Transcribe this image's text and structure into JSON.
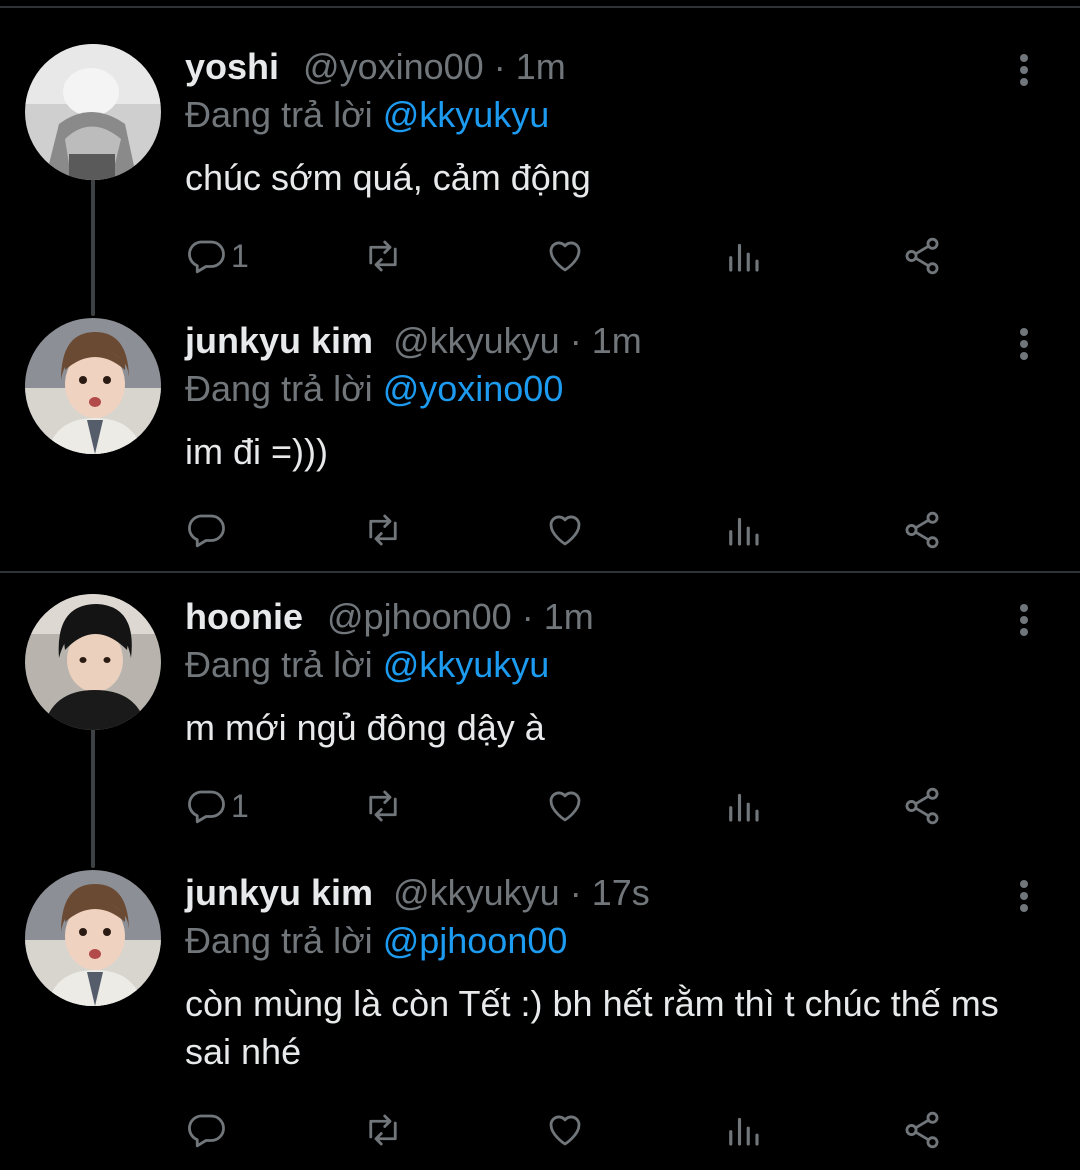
{
  "replying_prefix": "Đang trả lời",
  "tweets": [
    {
      "name": "yoshi",
      "handle": "@yoxino00",
      "time": "1m",
      "reply_to": "@kkyukyu",
      "text": "chúc sớm quá, cảm động",
      "reply_count": "1",
      "avatar": "grayscale-photo"
    },
    {
      "name": "junkyu kim",
      "handle": "@kkyukyu",
      "time": "1m",
      "reply_to": "@yoxino00",
      "text": "im đi =)))",
      "reply_count": "",
      "avatar": "color-photo"
    },
    {
      "name": "hoonie",
      "handle": "@pjhoon00",
      "time": "1m",
      "reply_to": "@kkyukyu",
      "text": "m mới ngủ đông dậy à",
      "reply_count": "1",
      "avatar": "dark-hoodie-photo"
    },
    {
      "name": "junkyu kim",
      "handle": "@kkyukyu",
      "time": "17s",
      "reply_to": "@pjhoon00",
      "text": "còn mùng là còn Tết :) bh hết rằm thì t chúc thế ms sai nhé",
      "reply_count": "",
      "avatar": "color-photo"
    }
  ],
  "icons": [
    "reply-icon",
    "retweet-icon",
    "like-icon",
    "analytics-icon",
    "share-icon",
    "more-icon"
  ],
  "colors": {
    "background": "#000000",
    "text": "#e7e9ea",
    "secondary": "#71767b",
    "link": "#1d9bf0"
  }
}
